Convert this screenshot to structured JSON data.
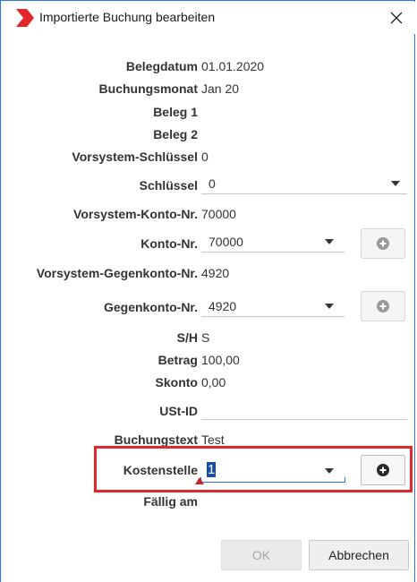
{
  "window": {
    "title": "Importierte Buchung bearbeiten"
  },
  "fields": {
    "belegdatum": {
      "label": "Belegdatum",
      "value": "01.01.2020"
    },
    "buchungsmonat": {
      "label": "Buchungsmonat",
      "value": "Jan 20"
    },
    "beleg1": {
      "label": "Beleg 1",
      "value": ""
    },
    "beleg2": {
      "label": "Beleg 2",
      "value": ""
    },
    "vorsystem_schluessel": {
      "label": "Vorsystem-Schlüssel",
      "value": "0"
    },
    "schluessel": {
      "label": "Schlüssel",
      "value": "0"
    },
    "vorsystem_konto": {
      "label": "Vorsystem-Konto-Nr.",
      "value": "70000"
    },
    "konto": {
      "label": "Konto-Nr.",
      "value": "70000"
    },
    "vorsystem_gegenkonto": {
      "label": "Vorsystem-Gegenkonto-Nr.",
      "value": "4920"
    },
    "gegenkonto": {
      "label": "Gegenkonto-Nr.",
      "value": "4920"
    },
    "sh": {
      "label": "S/H",
      "value": "S"
    },
    "betrag": {
      "label": "Betrag",
      "value": "100,00"
    },
    "skonto": {
      "label": "Skonto",
      "value": "0,00"
    },
    "ustid": {
      "label": "USt-ID",
      "value": ""
    },
    "buchungstext": {
      "label": "Buchungstext",
      "value": "Test"
    },
    "kostenstelle": {
      "label": "Kostenstelle",
      "value": "1"
    },
    "faellig_am": {
      "label": "Fällig am",
      "value": ""
    }
  },
  "buttons": {
    "ok": "OK",
    "cancel": "Abbrechen"
  },
  "colors": {
    "accent": "#2b79d6",
    "highlight": "#e0282c",
    "logo": "#e0282c",
    "selection": "#1a4fa8"
  },
  "icons": {
    "logo": "app-logo-chevron",
    "close": "close-icon",
    "dropdown": "chevron-down-icon",
    "add": "plus-circle-icon",
    "error": "error-triangle-icon"
  }
}
